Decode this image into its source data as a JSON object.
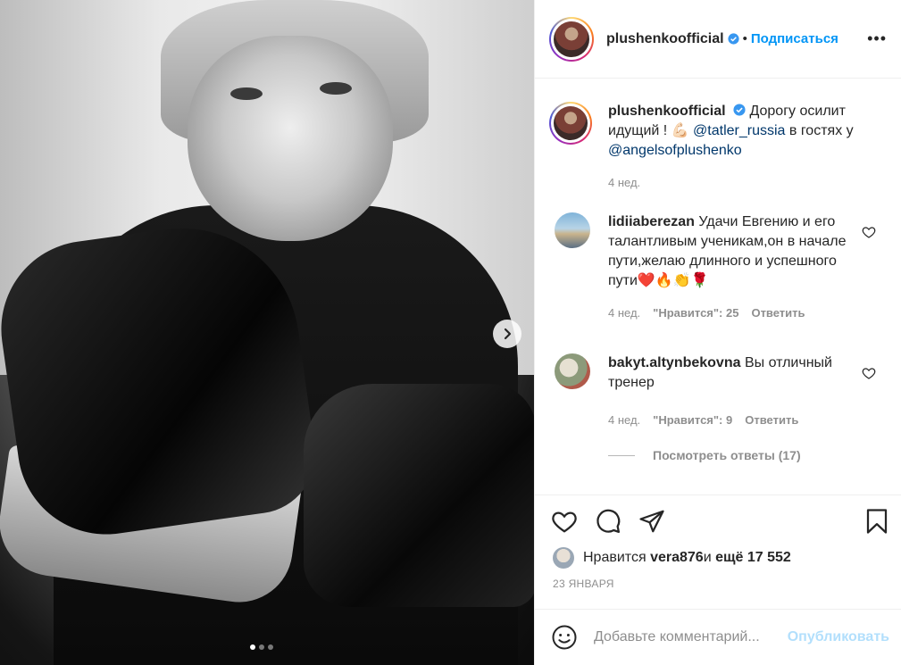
{
  "post": {
    "author": "plushenkoofficial",
    "follow_label": "Подписаться",
    "bullet": "•",
    "caption_text": "Дорогу осилит идущий ! 💪🏻",
    "caption_mention1": "@tatler_russia",
    "caption_middle": " в гостях у ",
    "caption_mention2": "@angelsofplushenko",
    "caption_time": "4 нед."
  },
  "comments": [
    {
      "user": "lidiiaberezan",
      "text": "Удачи Евгению и его талантливым ученикам,он в начале пути,желаю длинного и успешного пути❤️🔥👏🌹",
      "time": "4 нед.",
      "likes": "\"Нравится\": 25",
      "reply": "Ответить"
    },
    {
      "user": "bakyt.altynbekovna",
      "text": "Вы отличный тренер",
      "time": "4 нед.",
      "likes": "\"Нравится\": 9",
      "reply": "Ответить"
    }
  ],
  "view_replies": "Посмотреть ответы (17)",
  "likes": {
    "prefix": "Нравится ",
    "user": "vera876",
    "middle": " и ",
    "rest": "ещё 17 552"
  },
  "date": "23 ЯНВАРЯ",
  "add_comment": {
    "placeholder": "Добавьте комментарий...",
    "publish": "Опубликовать"
  },
  "carousel": {
    "count": 3,
    "active": 1
  },
  "colors": {
    "accent": "#0095f6",
    "muted": "#8e8e8e",
    "mention": "#00376b"
  },
  "icons": [
    "more-icon",
    "verified-icon",
    "heart-icon",
    "comment-icon",
    "share-icon",
    "bookmark-icon",
    "emoji-icon",
    "chevron-right-icon"
  ]
}
